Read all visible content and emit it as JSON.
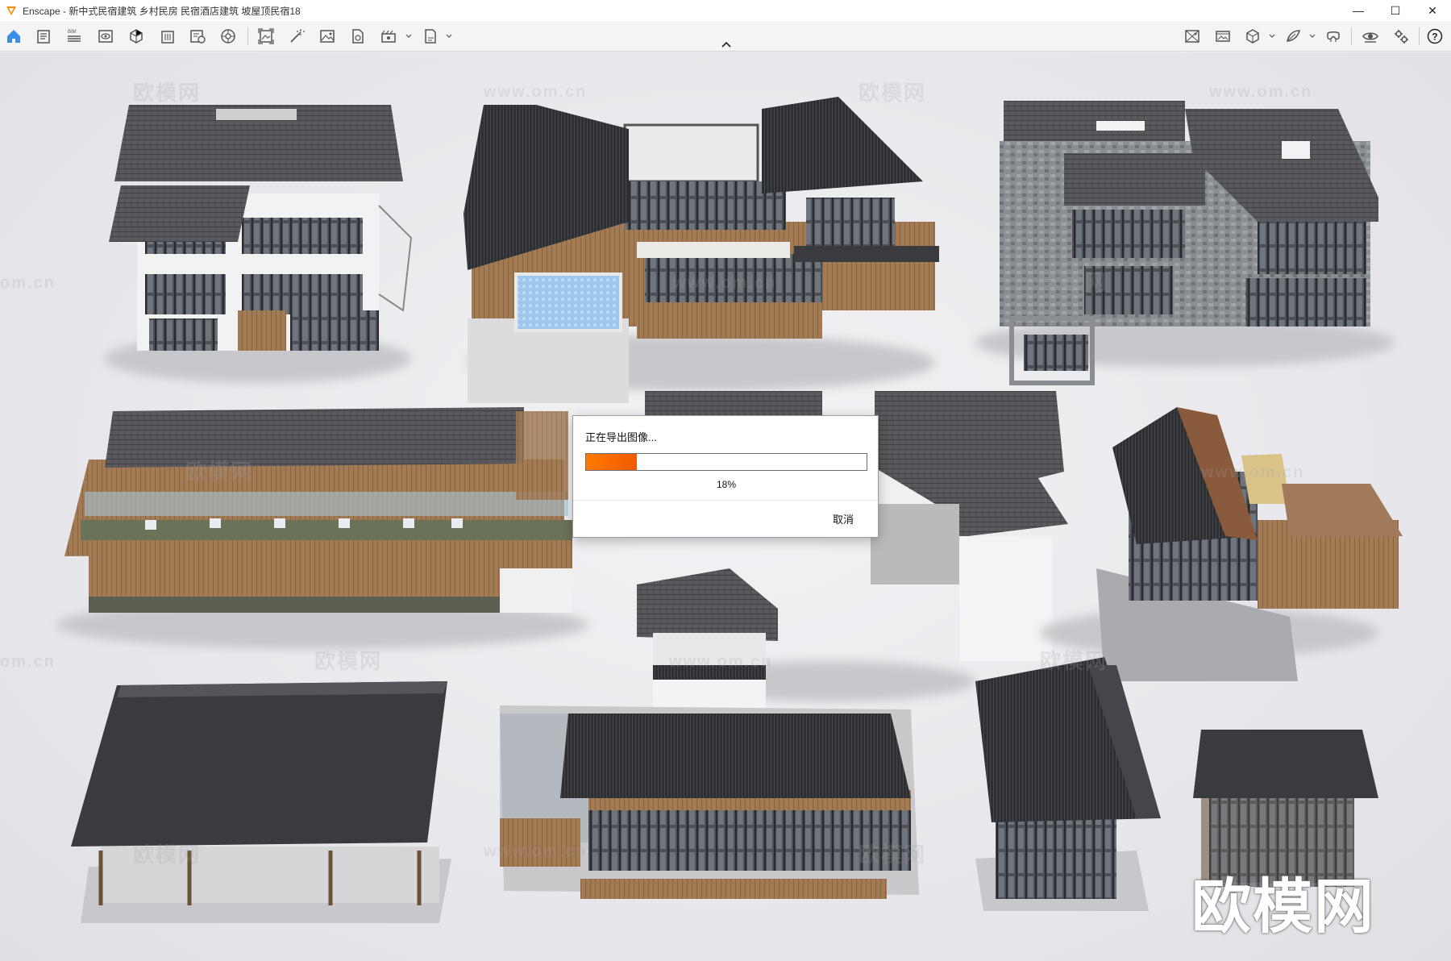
{
  "window": {
    "title": "Enscape - 新中式民宿建筑 乡村民房 民宿酒店建筑 坡屋顶民宿18",
    "controls": [
      "—",
      "☐",
      "✕"
    ]
  },
  "toolbar": {
    "left_icons": [
      "home-icon",
      "document-icon",
      "bim-icon",
      "eye-view-icon",
      "view-cube-icon",
      "building-icon",
      "site-context-icon",
      "asset-library-icon",
      "render-image-icon",
      "magic-wand-icon",
      "image-icon",
      "material-icon",
      "video-camera-icon",
      "export-icon"
    ],
    "right_icons": [
      "panorama-icon",
      "gallery-icon",
      "box-view-icon",
      "material-editor-icon",
      "vr-headset-icon",
      "visibility-icon",
      "settings-icon",
      "help-icon"
    ],
    "bim_label": "BIM"
  },
  "watermarks": {
    "large": "欧模网",
    "url": "www.om.cn",
    "partial": "om.cn",
    "brand": "欧模网"
  },
  "dialog": {
    "title": "正在导出图像...",
    "progress_fraction": 0.18,
    "percent_label": "18%",
    "cancel_label": "取消"
  },
  "colors": {
    "accent": "#ff7a00",
    "app_logo": "#f28c00",
    "home_icon": "#3c8de8"
  }
}
